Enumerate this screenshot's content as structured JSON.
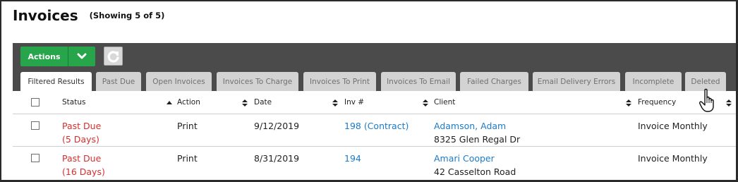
{
  "page": {
    "title": "Invoices",
    "subtitle": "(Showing 5 of 5)"
  },
  "toolbar": {
    "actions_label": "Actions",
    "actions_dropdown_icon": "chevron-down-icon",
    "refresh_icon": "refresh-icon",
    "accent_color": "#27a54a"
  },
  "tabs": [
    {
      "label": "Filtered Results",
      "active": true
    },
    {
      "label": "Past Due",
      "active": false
    },
    {
      "label": "Open Invoices",
      "active": false
    },
    {
      "label": "Invoices To Charge",
      "active": false
    },
    {
      "label": "Invoices To Print",
      "active": false
    },
    {
      "label": "Invoices To Email",
      "active": false
    },
    {
      "label": "Failed Charges",
      "active": false
    },
    {
      "label": "Email Delivery Errors",
      "active": false
    },
    {
      "label": "Incomplete",
      "active": false
    },
    {
      "label": "Deleted",
      "active": false
    }
  ],
  "table": {
    "columns": [
      {
        "label": "Status",
        "sort": "ascending"
      },
      {
        "label": "Action",
        "sort": "none"
      },
      {
        "label": "Date",
        "sort": "none"
      },
      {
        "label": "Inv #",
        "sort": "none"
      },
      {
        "label": "Client",
        "sort": "none"
      },
      {
        "label": "Frequency",
        "sort": "none"
      }
    ],
    "rows": [
      {
        "status": "Past Due",
        "status_detail": "(5 Days)",
        "action": "Print",
        "date": "9/12/2019",
        "invoice": "198 (Contract)",
        "client_name": "Adamson, Adam",
        "client_address": "8325 Glen Regal Dr",
        "frequency": "Invoice Monthly"
      },
      {
        "status": "Past Due",
        "status_detail": "(16 Days)",
        "action": "Print",
        "date": "8/31/2019",
        "invoice": "194",
        "client_name": "Amari Cooper",
        "client_address": "42 Casselton Road",
        "frequency": "Invoice Monthly"
      }
    ]
  },
  "colors": {
    "toolbar_bg": "#4b4b4b",
    "status_past_due": "#d62f2f",
    "link": "#1b7bc9"
  },
  "cursor_icon": "hand-pointer-icon"
}
